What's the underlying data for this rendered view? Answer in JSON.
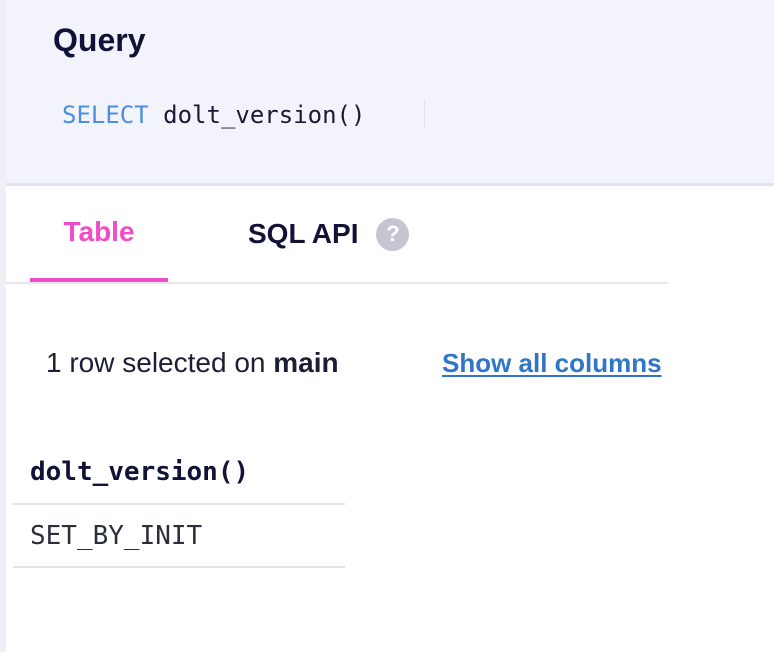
{
  "query": {
    "title": "Query",
    "keyword": "SELECT",
    "expression": "dolt_version()"
  },
  "tabs": {
    "table_label": "Table",
    "sql_api_label": "SQL API",
    "help_icon": "?"
  },
  "results": {
    "summary_prefix": "1 row selected on",
    "branch": "main",
    "show_all_columns": "Show all columns",
    "columns": [
      "dolt_version()"
    ],
    "rows": [
      [
        "SET_BY_INIT"
      ]
    ]
  },
  "icons": {
    "help": "question-circle-icon"
  },
  "colors": {
    "accent_pink": "#f04bc8",
    "link_blue": "#2f75c8",
    "sql_keyword_blue": "#4b8fe0"
  }
}
